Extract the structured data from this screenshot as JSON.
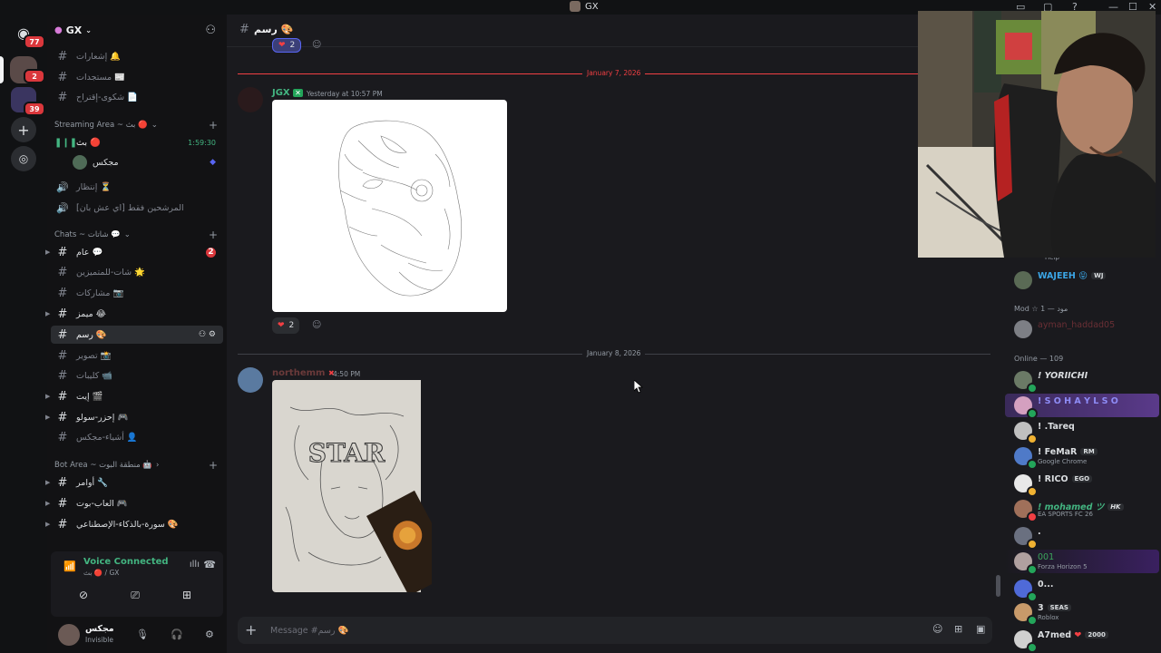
{
  "window": {
    "title": "GX"
  },
  "rail": {
    "home_badge": "77",
    "server_badge_1": "2",
    "server_badge_2": "39"
  },
  "server": {
    "name": "GX"
  },
  "channels": {
    "top": [
      {
        "label": "إشعارات",
        "emoji": "🔔"
      },
      {
        "label": "مستجدات",
        "emoji": "📰"
      },
      {
        "label": "شكوى-إقتراح",
        "emoji": "📄"
      }
    ],
    "streaming_category": "Streaming Area ~ بث 🔴",
    "stream_channel": {
      "label": "بث",
      "emoji": "🔴",
      "timer": "1:59:30"
    },
    "stream_user": "مجكس",
    "voice_waiting": {
      "label": "إنتظار",
      "emoji": "⏳"
    },
    "voice_candidates": "المرشحين فقط [اي عش بان]",
    "chats_category": "Chats ~ شاتات 💬",
    "chats": [
      {
        "label": "عام",
        "emoji": "💬",
        "badge": "2"
      },
      {
        "label": "شات-للمتميزين",
        "emoji": "🌟"
      },
      {
        "label": "مشاركات",
        "emoji": "📷"
      },
      {
        "label": "ميمز",
        "emoji": "😂"
      },
      {
        "label": "رسم",
        "emoji": "🎨"
      },
      {
        "label": "تصوير",
        "emoji": "📸"
      },
      {
        "label": "كليبات",
        "emoji": "📹"
      },
      {
        "label": "إيت",
        "emoji": "🎬"
      },
      {
        "label": "إحزر-سولو",
        "emoji": "🎮"
      },
      {
        "label": "أشياء-مجكس",
        "emoji": "👤"
      }
    ],
    "bot_category": "Bot Area ~ منطقة البوت 🤖",
    "bots": [
      {
        "label": "أوامر",
        "emoji": "🔧"
      },
      {
        "label": "العاب-بوت",
        "emoji": "🎮"
      },
      {
        "label": "سورة-بالذكاء-الإصطناعي",
        "emoji": "🎨"
      }
    ]
  },
  "voice": {
    "status": "Voice Connected",
    "sub": "بث 🔴 / GX"
  },
  "user": {
    "name": "مجكس",
    "status": "Invisible"
  },
  "chat": {
    "channel_name": "رسم",
    "channel_emoji": "🎨",
    "top_reaction_count": "2",
    "date1": "January 7, 2026",
    "msg1": {
      "author": "JGX",
      "time": "Yesterday at 10:57 PM",
      "reaction_count": "2"
    },
    "date2": "January 8, 2026",
    "msg2": {
      "author": "northemm",
      "time": "4:50 PM",
      "drawing_text": "STAR"
    },
    "composer_placeholder": "Message #رسم 🎨"
  },
  "members": {
    "group_help": "Help",
    "wajeeh": {
      "name": "WAJEEH",
      "tag": "WJ"
    },
    "group_mod": "Mod ☆ 1 — مود",
    "mod": {
      "name": "ayman_haddad05"
    },
    "group_online": "Online — 109",
    "list": [
      {
        "name": "! YORIICHI",
        "activity": "",
        "color": "#f2f3f5"
      },
      {
        "name": "! S O H A Y L S O",
        "activity": "",
        "color": "#8e8cf6"
      },
      {
        "name": "! .Tareq",
        "activity": "",
        "color": "#f2f3f5"
      },
      {
        "name": "! FeMaR",
        "tag": "RM",
        "activity": "Google Chrome",
        "color": "#f2f3f5"
      },
      {
        "name": "! RICO",
        "tag": "EGO",
        "activity": "",
        "color": "#f2f3f5"
      },
      {
        "name": "! mohamed ツ",
        "tag": "HK",
        "activity": "EA SPORTS FC 26",
        "color": "#43b581"
      },
      {
        "name": ".",
        "activity": "",
        "color": "#f2f3f5"
      },
      {
        "name": "001",
        "activity": "Forza Horizon 5",
        "color": "#3ba55c"
      },
      {
        "name": "0...",
        "activity": "",
        "color": "#f2f3f5"
      },
      {
        "name": "3",
        "tag": "SEAS",
        "activity": "Roblox",
        "color": "#f2f3f5"
      },
      {
        "name": "A7med",
        "tag": "2000",
        "activity": "",
        "color": "#f2f3f5"
      }
    ]
  }
}
